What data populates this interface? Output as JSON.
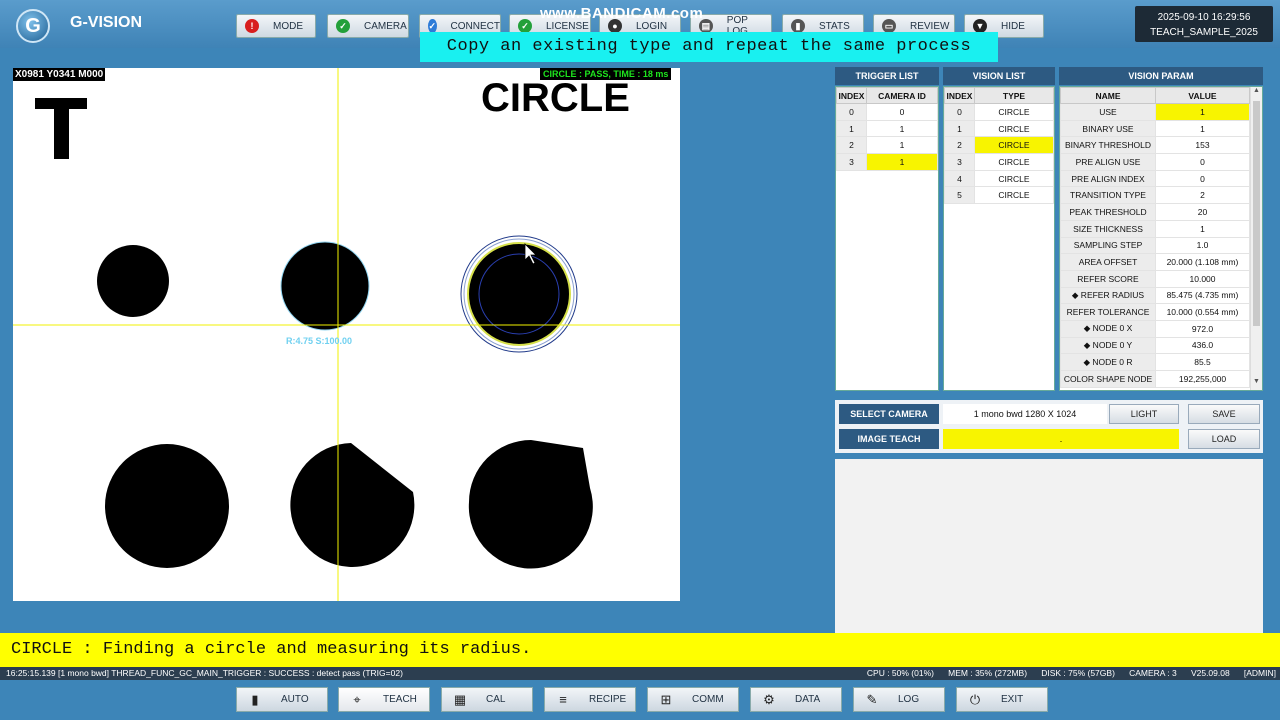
{
  "app": {
    "title": "G-VISION",
    "logo": "G",
    "datetime": "2025-09-10 16:29:56",
    "teach": "TEACH_SAMPLE_2025",
    "watermark": "www.BANDICAM.com"
  },
  "toolbar": [
    {
      "label": "MODE",
      "icon": "stop-icon",
      "color": "#d81e1e",
      "glyph": "!"
    },
    {
      "label": "CAMERA",
      "icon": "check-icon",
      "color": "#23a03a",
      "glyph": "✓"
    },
    {
      "label": "CONNECT",
      "icon": "check-icon",
      "color": "#2d7bd8",
      "glyph": "✓"
    },
    {
      "label": "LICENSE",
      "icon": "check-icon",
      "color": "#23a03a",
      "glyph": "✓"
    },
    {
      "label": "LOGIN",
      "icon": "user-icon",
      "color": "#333",
      "glyph": "●"
    },
    {
      "label": "POP LOG",
      "icon": "log-icon",
      "color": "#555",
      "glyph": "▤"
    },
    {
      "label": "STATS",
      "icon": "chart-icon",
      "color": "#555",
      "glyph": "▮"
    },
    {
      "label": "REVIEW",
      "icon": "folder-icon",
      "color": "#555",
      "glyph": "▭"
    },
    {
      "label": "HIDE",
      "icon": "chevron-down-icon",
      "color": "#222",
      "glyph": "▼"
    }
  ],
  "caption": "Copy an existing type and repeat the same process",
  "viewer": {
    "coord": "X0981 Y0341 M000",
    "result": "CIRCLE : PASS, TIME : 18 ms",
    "label_t": "T",
    "label_type": "CIRCLE",
    "measure": "R:4.75 S:100.00"
  },
  "trigger": {
    "title": "TRIGGER LIST",
    "cols": [
      "INDEX",
      "CAMERA ID"
    ],
    "rows": [
      [
        "0",
        "0"
      ],
      [
        "1",
        "1"
      ],
      [
        "2",
        "1"
      ],
      [
        "3",
        "1"
      ]
    ]
  },
  "vision": {
    "title": "VISION LIST",
    "cols": [
      "INDEX",
      "TYPE"
    ],
    "rows": [
      [
        "0",
        "CIRCLE"
      ],
      [
        "1",
        "CIRCLE"
      ],
      [
        "2",
        "CIRCLE"
      ],
      [
        "3",
        "CIRCLE"
      ],
      [
        "4",
        "CIRCLE"
      ],
      [
        "5",
        "CIRCLE"
      ]
    ]
  },
  "param": {
    "title": "VISION PARAM",
    "cols": [
      "NAME",
      "VALUE"
    ],
    "rows": [
      [
        "USE",
        "1"
      ],
      [
        "BINARY USE",
        "1"
      ],
      [
        "BINARY THRESHOLD",
        "153"
      ],
      [
        "PRE ALIGN USE",
        "0"
      ],
      [
        "PRE ALIGN INDEX",
        "0"
      ],
      [
        "TRANSITION TYPE",
        "2"
      ],
      [
        "PEAK THRESHOLD",
        "20"
      ],
      [
        "SIZE THICKNESS",
        "1"
      ],
      [
        "SAMPLING STEP",
        "1.0"
      ],
      [
        "AREA OFFSET",
        "20.000 (1.108 mm)"
      ],
      [
        "REFER SCORE",
        "10.000"
      ],
      [
        "◆ REFER RADIUS",
        "85.475 (4.735 mm)"
      ],
      [
        "REFER TOLERANCE",
        "10.000 (0.554 mm)"
      ],
      [
        "◆ NODE 0 X",
        "972.0"
      ],
      [
        "◆ NODE 0 Y",
        "436.0"
      ],
      [
        "◆ NODE 0 R",
        "85.5"
      ],
      [
        "COLOR SHAPE NODE",
        "192,255,000"
      ]
    ]
  },
  "camera": {
    "select_label": "SELECT CAMERA",
    "value": "1 mono bwd  1280 X 1024",
    "light": "LIGHT",
    "save": "SAVE",
    "teach_label": "IMAGE TEACH",
    "teach_value": ".",
    "load": "LOAD"
  },
  "message": "CIRCLE : Finding a circle and measuring its radius.",
  "status": {
    "left": "16:25:15.139  [1 mono bwd] THREAD_FUNC_GC_MAIN_TRIGGER : SUCCESS : detect pass (TRIG=02)",
    "right": "CPU : 50% (01%)      MEM : 35% (272MB)      DISK : 75% (57GB)      CAMERA : 3      V25.09.08      [ADMIN]"
  },
  "bottom": [
    {
      "label": "AUTO",
      "icon": "auto-icon",
      "glyph": "▮"
    },
    {
      "label": "TEACH",
      "icon": "teach-icon",
      "glyph": "⌖"
    },
    {
      "label": "CAL",
      "icon": "grid-icon",
      "glyph": "▦"
    },
    {
      "label": "RECIPE",
      "icon": "database-icon",
      "glyph": "≡"
    },
    {
      "label": "COMM",
      "icon": "network-icon",
      "glyph": "⊞"
    },
    {
      "label": "DATA",
      "icon": "gear-icon",
      "glyph": "⚙"
    },
    {
      "label": "LOG",
      "icon": "log-icon",
      "glyph": "✎"
    },
    {
      "label": "EXIT",
      "icon": "power-icon",
      "glyph": "⏻"
    }
  ]
}
